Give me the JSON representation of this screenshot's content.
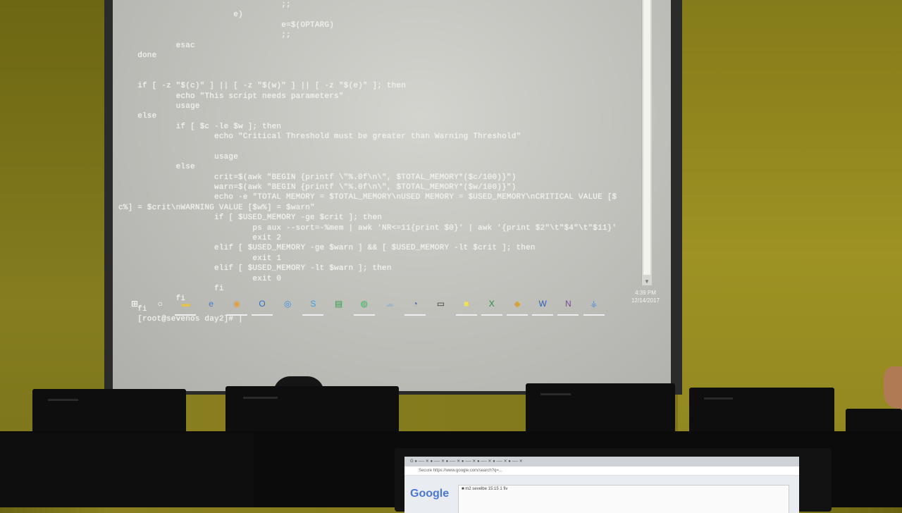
{
  "terminal": {
    "lines": [
      "                                  ;;",
      "                        e)",
      "                                  e=$(OPTARG)",
      "                                  ;;",
      "            esac",
      "    done",
      "",
      "",
      "    if [ -z \"$(c)\" ] || [ -z \"$(w)\" ] || [ -z \"$(e)\" ]; then",
      "            echo \"This script needs parameters\"",
      "            usage",
      "    else",
      "            if [ $c -le $w ]; then",
      "                    echo \"Critical Threshold must be greater than Warning Threshold\"",
      "",
      "                    usage",
      "            else",
      "                    crit=$(awk \"BEGIN {printf \\\"%.0f\\n\\\", $TOTAL_MEMORY*($c/100)}\")",
      "                    warn=$(awk \"BEGIN {printf \\\"%.0f\\n\\\", $TOTAL_MEMORY*($w/100)}\")",
      "                    echo -e \"TOTAL MEMORY = $TOTAL_MEMORY\\nUSED MEMORY = $USED_MEMORY\\nCRITICAL VALUE [$",
      "c%] = $crit\\nWARNING VALUE [$w%] = $warn\"",
      "                    if [ $USED_MEMORY -ge $crit ]; then",
      "                            ps aux --sort=-%mem | awk 'NR<=11{print $0}' | awk '{print $2\"\\t\"$4\"\\t\"$11}'",
      "                            exit 2",
      "                    elif [ $USED_MEMORY -ge $warn ] && [ $USED_MEMORY -lt $crit ]; then",
      "                            exit 1",
      "                    elif [ $USED_MEMORY -lt $warn ]; then",
      "                            exit 0",
      "                    fi",
      "            fi",
      "    fi",
      "    [root@sevenos day2]# |"
    ]
  },
  "taskbar": {
    "icons": [
      {
        "name": "windows-start-icon",
        "glyph": "⊞",
        "color": "#ffffff",
        "active": false
      },
      {
        "name": "cortana-icon",
        "glyph": "○",
        "color": "#ffffff",
        "active": false
      },
      {
        "name": "file-explorer-icon",
        "glyph": "▬",
        "color": "#e8c34a",
        "active": true
      },
      {
        "name": "edge-icon",
        "glyph": "e",
        "color": "#2f7fd6",
        "active": false
      },
      {
        "name": "chrome-icon",
        "glyph": "◉",
        "color": "#e0a13a",
        "active": true
      },
      {
        "name": "outlook-icon",
        "glyph": "O",
        "color": "#2e6fc7",
        "active": true
      },
      {
        "name": "chat-icon",
        "glyph": "◎",
        "color": "#3f8ed8",
        "active": false
      },
      {
        "name": "skype-icon",
        "glyph": "S",
        "color": "#3aa0e0",
        "active": true
      },
      {
        "name": "sticky-app-icon",
        "glyph": "▤",
        "color": "#3a9a4a",
        "active": false
      },
      {
        "name": "spotify-icon",
        "glyph": "◍",
        "color": "#2fbf57",
        "active": true
      },
      {
        "name": "cloud-icon",
        "glyph": "☁",
        "color": "#9fb7c8",
        "active": false
      },
      {
        "name": "vpn-lock-icon",
        "glyph": "◔",
        "color": "#3b6fb0",
        "active": true
      },
      {
        "name": "terminal-icon",
        "glyph": "▭",
        "color": "#333333",
        "active": false
      },
      {
        "name": "sticky-notes-icon",
        "glyph": "■",
        "color": "#f0e24a",
        "active": true
      },
      {
        "name": "excel-icon",
        "glyph": "X",
        "color": "#2a8a4a",
        "active": true
      },
      {
        "name": "visio-icon",
        "glyph": "◆",
        "color": "#d8a23a",
        "active": true
      },
      {
        "name": "word-icon",
        "glyph": "W",
        "color": "#2f5fb8",
        "active": true
      },
      {
        "name": "onenote-icon",
        "glyph": "N",
        "color": "#8a3fb0",
        "active": true
      },
      {
        "name": "network-icon",
        "glyph": "⚶",
        "color": "#5a8fd0",
        "active": true
      }
    ],
    "clock_time": "4:39 PM",
    "clock_date": "12/14/2017"
  },
  "laptop": {
    "tabs_text": "G  ● ── ✕  ● ── ✕  ● ── ✕  ● ── ✕  ● ── ✕  ● ── ✕  ● ── ✕",
    "url_text": "Secure  https://www.google.com/search?q=...",
    "logo": "Google",
    "window_title": "■ m2 sevelbe 15:15 1 fiv"
  }
}
